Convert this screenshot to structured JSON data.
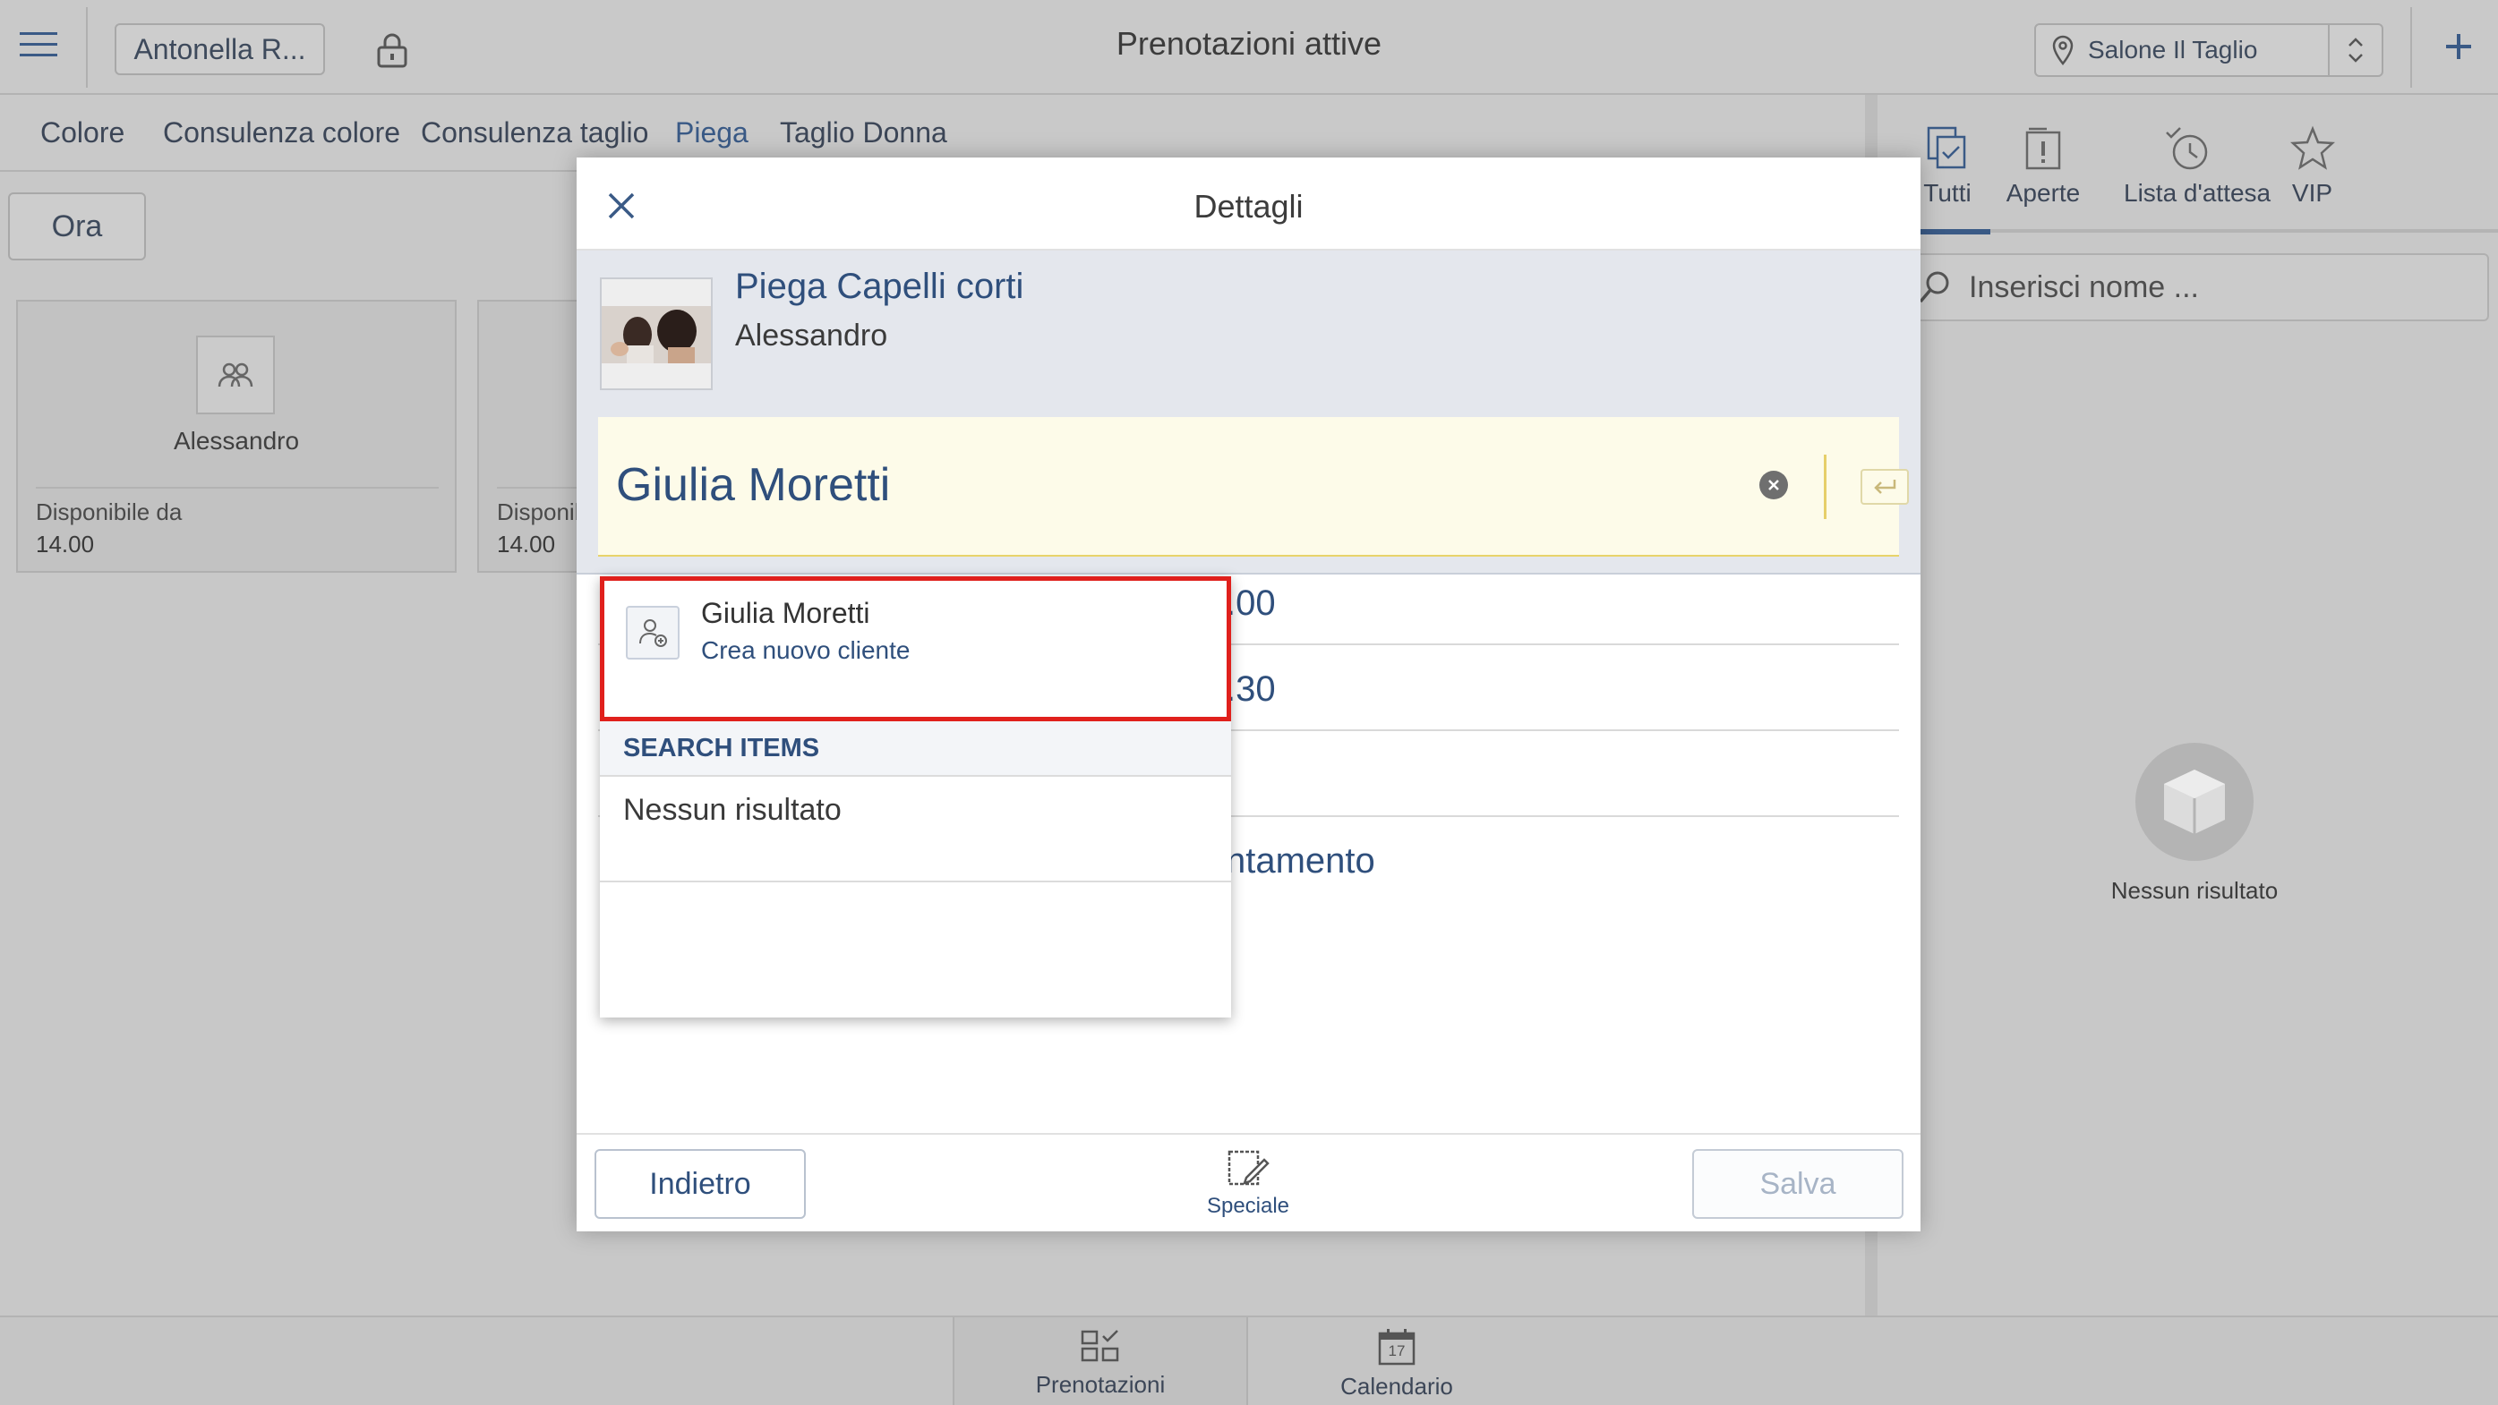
{
  "header": {
    "user_label": "Antonella R...",
    "title": "Prenotazioni attive",
    "location": "Salone Il Taglio"
  },
  "categories": [
    "Colore",
    "Consulenza colore",
    "Consulenza taglio",
    "Piega",
    "Taglio Donna"
  ],
  "time_filter": "Ora",
  "staff_cards": [
    {
      "name": "Alessandro",
      "avail_label": "Disponibile da",
      "avail_time": "14.00"
    },
    {
      "name": "",
      "avail_label": "Disponibile da",
      "avail_time": "14.00"
    }
  ],
  "right_panel": {
    "tabs": [
      "Tutti",
      "Aperte",
      "Lista d'attesa",
      "VIP"
    ],
    "selected_tab": "Tutti",
    "search_placeholder": "Inserisci nome ...",
    "empty_text": "Nessun risultato"
  },
  "bottom_nav": [
    "Prenotazioni",
    "Calendario"
  ],
  "calendar_day": "17",
  "modal": {
    "title": "Dettagli",
    "service_title": "Piega Capelli corti",
    "service_staff": "Alessandro",
    "client_name": "Giulia Moretti",
    "rows": [
      ".00",
      ".30",
      "",
      "ntamento"
    ],
    "back_label": "Indietro",
    "special_label": "Speciale",
    "save_label": "Salva"
  },
  "dropdown": {
    "suggest_name": "Giulia Moretti",
    "suggest_action": "Crea nuovo cliente",
    "section_label": "SEARCH ITEMS",
    "empty_text": "Nessun risultato"
  },
  "colors": {
    "accent": "#2f4f7c",
    "highlight_border": "#e0201c",
    "name_field_bg": "#fdfbe9"
  }
}
